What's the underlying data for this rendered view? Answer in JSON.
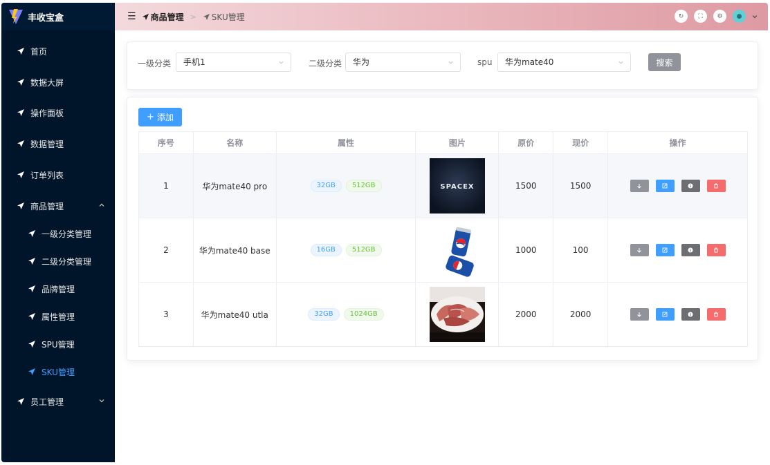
{
  "app": {
    "title": "丰收宝盒"
  },
  "sidebar": {
    "items": [
      {
        "label": "首页"
      },
      {
        "label": "数据大屏"
      },
      {
        "label": "操作面板"
      },
      {
        "label": "数据管理"
      },
      {
        "label": "订单列表"
      },
      {
        "label": "商品管理",
        "expanded": true
      },
      {
        "label": "一级分类管理"
      },
      {
        "label": "二级分类管理"
      },
      {
        "label": "品牌管理"
      },
      {
        "label": "属性管理"
      },
      {
        "label": "SPU管理"
      },
      {
        "label": "SKU管理",
        "active": true
      },
      {
        "label": "员工管理",
        "expanded": false
      }
    ]
  },
  "header": {
    "breadcrumb": [
      "商品管理",
      "SKU管理"
    ],
    "icons": [
      "refresh-icon",
      "fullscreen-icon",
      "settings-icon",
      "avatar",
      "chevron-down-icon"
    ]
  },
  "filters": {
    "category1": {
      "label": "一级分类",
      "value": "手机1"
    },
    "category2": {
      "label": "二级分类",
      "value": "华为"
    },
    "spu": {
      "label": "spu",
      "value": "华为mate40"
    },
    "search_label": "搜索"
  },
  "table": {
    "add_label": "添加",
    "columns": [
      "序号",
      "名称",
      "属性",
      "图片",
      "原价",
      "现价",
      "操作"
    ],
    "rows": [
      {
        "index": "1",
        "name": "华为mate40 pro",
        "attrs": [
          "32GB",
          "512GB"
        ],
        "image": "spacex-logo-image",
        "image_text": "SPACEX",
        "price": "1500",
        "current": "1500"
      },
      {
        "index": "2",
        "name": "华为mate40 base",
        "attrs": [
          "16GB",
          "512GB"
        ],
        "image": "pepsi-cans-image",
        "image_text": "",
        "price": "1000",
        "current": "100"
      },
      {
        "index": "3",
        "name": "华为mate40 utla",
        "attrs": [
          "32GB",
          "1024GB"
        ],
        "image": "sliced-meat-image",
        "image_text": "",
        "price": "2000",
        "current": "2000"
      }
    ]
  },
  "colors": {
    "sidebar_bg": "#001529",
    "primary": "#409eff",
    "active": "#409eff",
    "success": "#67c23a",
    "danger": "#f56c6c",
    "info": "#909399"
  }
}
